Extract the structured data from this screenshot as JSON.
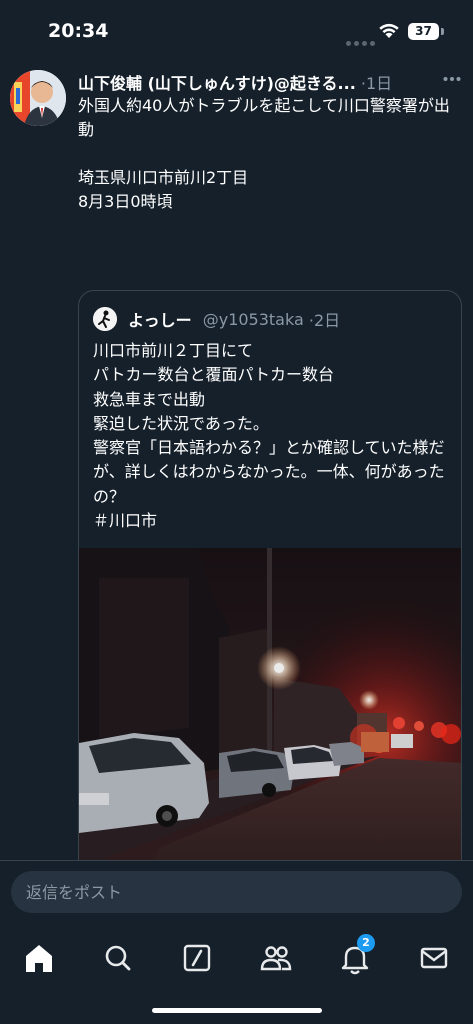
{
  "status_bar": {
    "time": "20:34",
    "battery": "37",
    "icons": [
      "signal-dots-icon",
      "wifi-icon",
      "battery-icon"
    ]
  },
  "tweet": {
    "author_name": "山下俊輔 (山下しゅんすけ)@起きる...",
    "time": "·1日",
    "text": "外国人約40人がトラブルを起こして川口警察署が出動\n\n埼玉県川口市前川2丁目\n8月3日0時頃",
    "quote": {
      "name": "よっしー",
      "handle": "@y1053taka",
      "time": "·2日",
      "text": "川口市前川２丁目にて\nパトカー数台と覆面パトカー数台\n救急車まで出動\n緊迫した状況であった。\n警察官「日本語わかる？」とか確認していた様だが、詳しくはわからなかった。一体、何があったの？\n＃川口市"
    }
  },
  "reply": {
    "placeholder": "返信をポスト"
  },
  "nav": {
    "items": [
      "home-icon",
      "search-icon",
      "compose-icon",
      "communities-icon",
      "notifications-icon",
      "messages-icon"
    ],
    "notification_count": "2"
  },
  "colors": {
    "background": "#15202b",
    "accent": "#1d9bf0",
    "muted_text": "#8b98a5",
    "border": "#38444d"
  }
}
